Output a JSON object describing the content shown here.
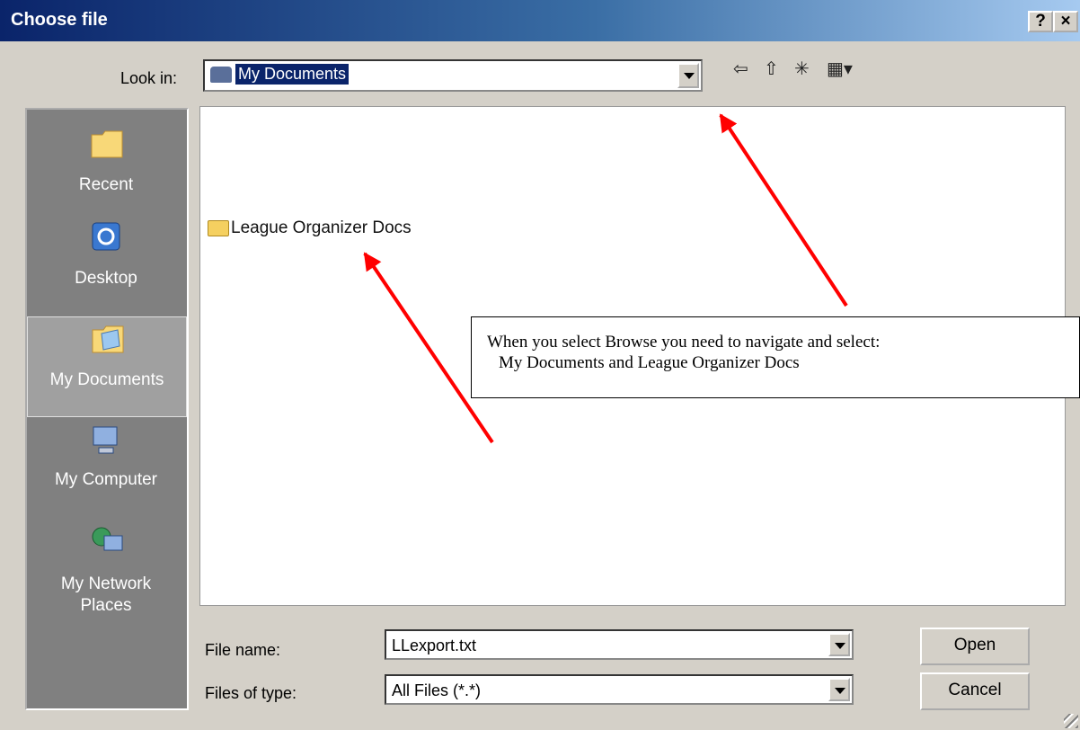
{
  "window": {
    "title": "Choose file",
    "help_label": "?",
    "close_label": "×"
  },
  "lookin": {
    "label": "Look in:",
    "value": "My Documents"
  },
  "toolbar": {
    "back_glyph": "⇦",
    "up_glyph": "⇧",
    "newfolder_glyph": "✳",
    "views_glyph": "▦▾"
  },
  "places": [
    {
      "label": "Recent"
    },
    {
      "label": "Desktop"
    },
    {
      "label": "My Documents"
    },
    {
      "label": "My Computer"
    },
    {
      "label": "My Network",
      "label2": "Places"
    }
  ],
  "files": [
    {
      "name": "League Organizer Docs"
    }
  ],
  "callout": {
    "line1": "When you select Browse you need to navigate and select:",
    "line2": "My Documents and League Organizer Docs"
  },
  "filename": {
    "label": "File name:",
    "value": "LLexport.txt"
  },
  "filetype": {
    "label": "Files of type:",
    "value": "All Files (*.*)"
  },
  "buttons": {
    "open": "Open",
    "cancel": "Cancel"
  },
  "colors": {
    "title_bar": "#0a246a",
    "arrow": "#ff0000",
    "places_bg": "#808080"
  }
}
